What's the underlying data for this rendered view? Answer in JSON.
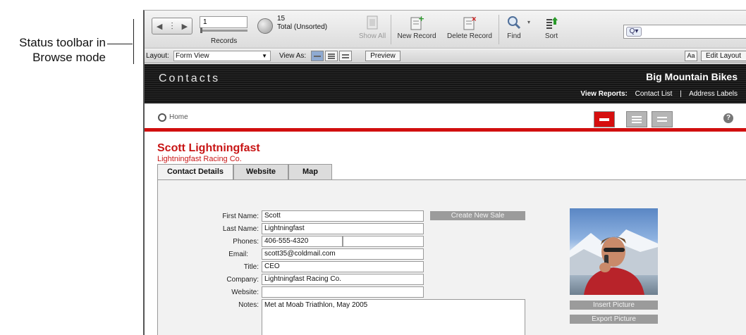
{
  "callout": {
    "line1": "Status toolbar in",
    "line2": "Browse mode"
  },
  "toolbar": {
    "record_number": "1",
    "records_label": "Records",
    "total_count": "15",
    "total_label": "Total (Unsorted)",
    "show_all_label": "Show All",
    "new_record_label": "New Record",
    "delete_record_label": "Delete Record",
    "find_label": "Find",
    "sort_label": "Sort",
    "search_placeholder": ""
  },
  "layoutbar": {
    "layout_label": "Layout:",
    "layout_value": "Form View",
    "view_as_label": "View As:",
    "preview_label": "Preview",
    "aa_label": "Aa",
    "edit_layout_label": "Edit Layout"
  },
  "header": {
    "app_title": "Contacts",
    "company": "Big Mountain Bikes",
    "view_reports_label": "View Reports:",
    "report_1": "Contact List",
    "report_2": "Address Labels"
  },
  "nav": {
    "home_label": "Home",
    "help": "?"
  },
  "record": {
    "name": "Scott Lightningfast",
    "company": "Lightningfast Racing Co."
  },
  "tabs": [
    "Contact Details",
    "Website",
    "Map"
  ],
  "form": {
    "labels": {
      "first_name": "First Name:",
      "last_name": "Last Name:",
      "phones": "Phones:",
      "email": "Email:",
      "title": "Title:",
      "company": "Company:",
      "website": "Website:",
      "notes": "Notes:"
    },
    "values": {
      "first_name": "Scott",
      "last_name": "Lightningfast",
      "phone_1": "406-555-4320",
      "phone_2": "",
      "email": "scott35@coldmail.com",
      "title": "CEO",
      "company": "Lightningfast Racing Co.",
      "website": "",
      "notes": "Met at Moab Triathlon, May 2005"
    },
    "create_new_sale_label": "Create New Sale",
    "insert_picture_label": "Insert Picture",
    "export_picture_label": "Export Picture"
  },
  "colors": {
    "accent_red": "#d10f0f",
    "header_dark": "#1a1a1a"
  }
}
